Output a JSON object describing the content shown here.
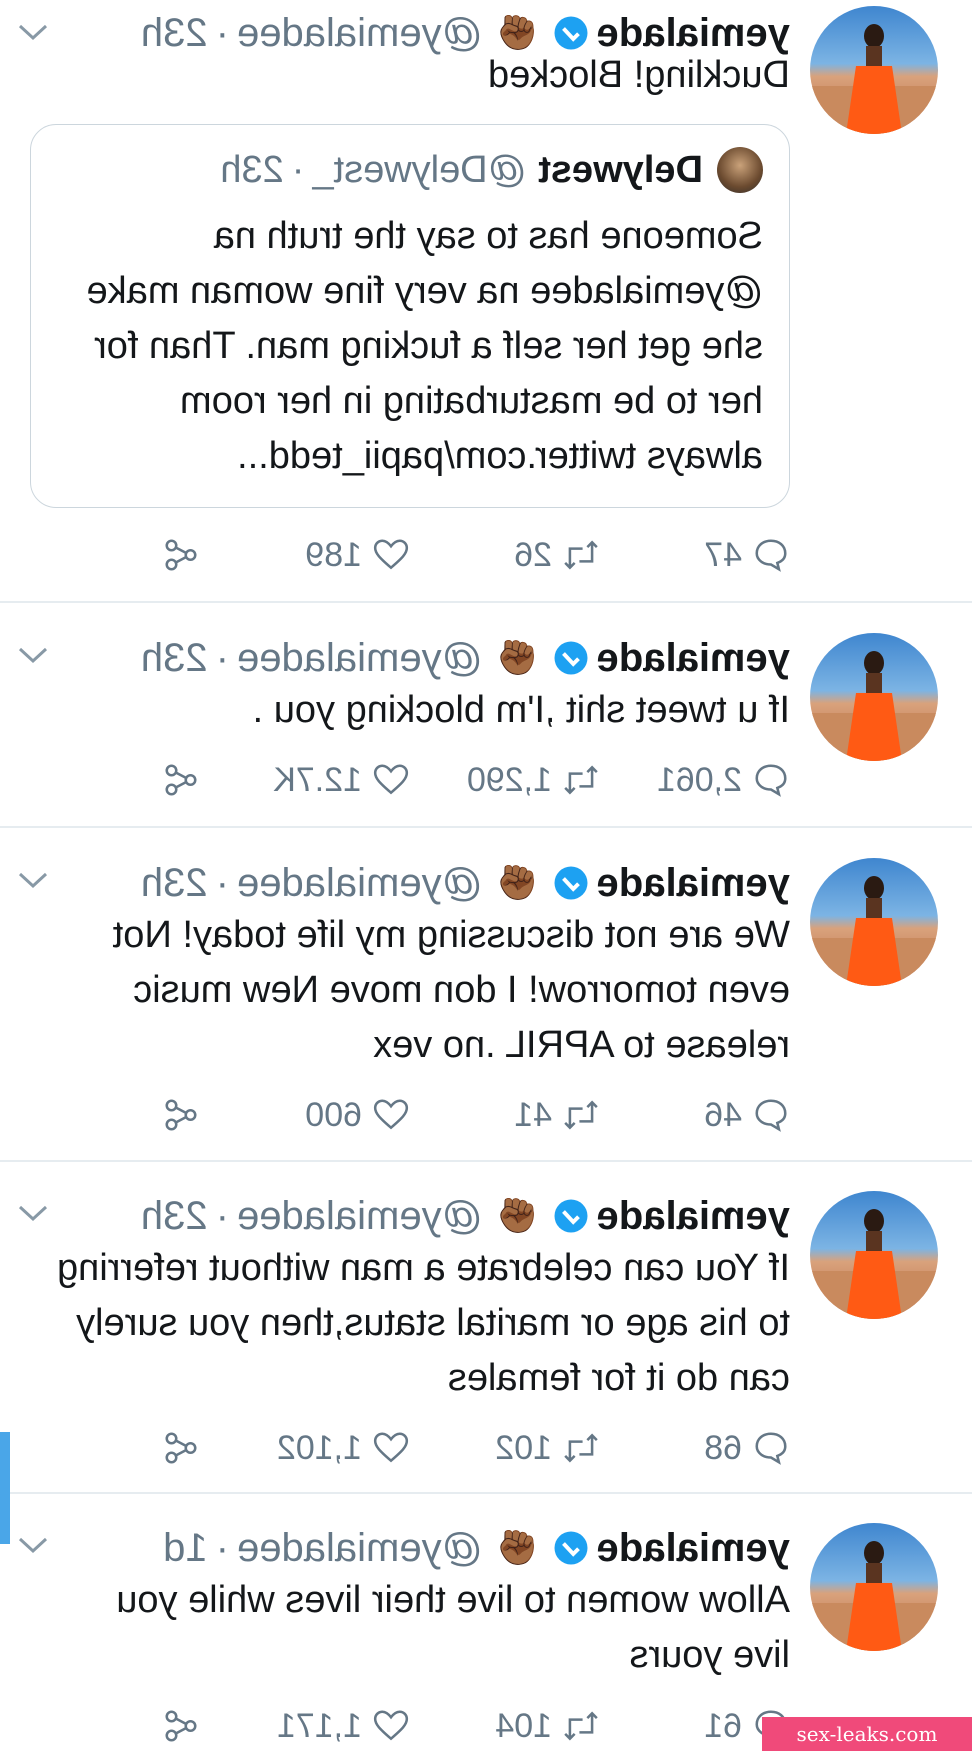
{
  "tweets": [
    {
      "name": "yemialade",
      "emoji": "✊🏾",
      "handle": "@yemialadee",
      "time": "23h",
      "text": "Duckling! Blocked",
      "quote": {
        "name": "Delywest",
        "handle": "@Delywest_",
        "time": "23h",
        "text": "Someone has to say the truth na @yemialadee na very fine woman make she get her self a fucking man. Than for her to be masturbating in her room always twitter.com/papii_tedd..."
      },
      "replies": "47",
      "retweets": "26",
      "likes": "189"
    },
    {
      "name": "yemialade",
      "emoji": "✊🏾",
      "handle": "@yemialadee",
      "time": "23h",
      "text": "If u tweet shit ,I'm blocking you .",
      "replies": "2,061",
      "retweets": "1,290",
      "likes": "12.7K"
    },
    {
      "name": "yemialade",
      "emoji": "✊🏾",
      "handle": "@yemialadee",
      "time": "23h",
      "text": "We are not discussing my life today! Not even tomorrow! I don move New music release to APRIL .no vex",
      "replies": "46",
      "retweets": "41",
      "likes": "600"
    },
    {
      "name": "yemialade",
      "emoji": "✊🏾",
      "handle": "@yemialadee",
      "time": "23h",
      "text": "If You can celebrate a man without referring to his age or marital status,then you surely can do it for females",
      "replies": "68",
      "retweets": "102",
      "likes": "1,102"
    },
    {
      "name": "yemialade",
      "emoji": "✊🏾",
      "handle": "@yemialadee",
      "time": "1d",
      "text": "Allow women to live their lives while you live yours",
      "replies": "61",
      "retweets": "104",
      "likes": "1,171"
    }
  ],
  "separator": "·",
  "watermark": "sex-leaks.com",
  "colors": {
    "text": "#14171a",
    "muted": "#657786",
    "verified": "#1da1f2",
    "divider": "#e6ecf0",
    "accent": "#4aa6e8",
    "watermark_bg": "#f04a7a"
  },
  "icons": {
    "reply": "reply-icon",
    "retweet": "retweet-icon",
    "like": "heart-icon",
    "share": "share-icon",
    "menu": "chevron-down-icon",
    "verified": "verified-badge-icon"
  }
}
